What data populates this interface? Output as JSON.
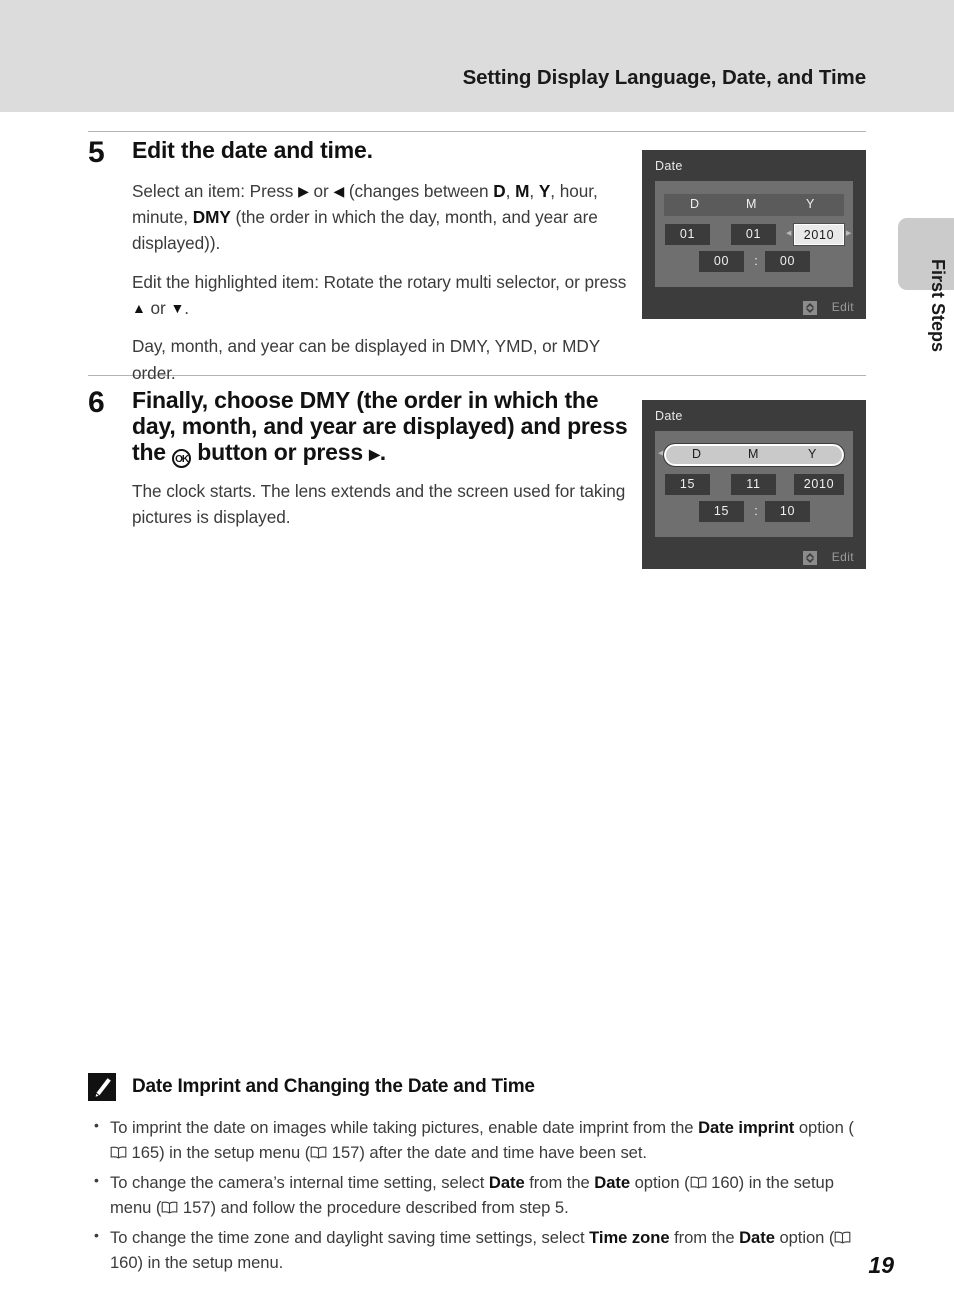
{
  "header": {
    "title": "Setting Display Language, Date, and Time"
  },
  "side_tab": {
    "label": "First Steps"
  },
  "steps": [
    {
      "number": "5",
      "heading": "Edit the date and time.",
      "paragraphs": [
        {
          "segments": [
            {
              "t": "Select an item: Press ",
              "style": "normal"
            },
            {
              "t": "▶",
              "style": "glyph"
            },
            {
              "t": " or ",
              "style": "normal"
            },
            {
              "t": "◀",
              "style": "glyph"
            },
            {
              "t": " (changes between ",
              "style": "normal"
            },
            {
              "t": "D",
              "style": "bold"
            },
            {
              "t": ", ",
              "style": "normal"
            },
            {
              "t": "M",
              "style": "bold"
            },
            {
              "t": ", ",
              "style": "normal"
            },
            {
              "t": "Y",
              "style": "bold"
            },
            {
              "t": ", hour, minute, ",
              "style": "normal"
            },
            {
              "t": "DMY",
              "style": "bold"
            },
            {
              "t": " (the order in which the day, month, and year are displayed)).",
              "style": "normal"
            }
          ]
        },
        {
          "segments": [
            {
              "t": "Edit the highlighted item: Rotate the rotary multi selector, or press ",
              "style": "normal"
            },
            {
              "t": "▲",
              "style": "glyph"
            },
            {
              "t": " or ",
              "style": "normal"
            },
            {
              "t": "▼",
              "style": "glyph"
            },
            {
              "t": ".",
              "style": "normal"
            }
          ]
        },
        {
          "segments": [
            {
              "t": "Day, month, and year can be displayed in DMY, YMD, or MDY order.",
              "style": "normal"
            }
          ]
        }
      ]
    },
    {
      "number": "6",
      "heading_segments": [
        {
          "t": "Finally, choose ",
          "style": "normal"
        },
        {
          "t": "DMY",
          "style": "bold"
        },
        {
          "t": " (the order in which the day, month, and year are displayed) and press the ",
          "style": "normal"
        },
        {
          "t": "OK",
          "style": "okbutton"
        },
        {
          "t": " button or press ",
          "style": "normal"
        },
        {
          "t": "▶",
          "style": "glyph"
        },
        {
          "t": ".",
          "style": "normal"
        }
      ],
      "paragraphs": [
        {
          "segments": [
            {
              "t": "The clock starts. The lens extends and the screen used for taking pictures is displayed.",
              "style": "normal"
            }
          ]
        }
      ]
    }
  ],
  "lcd_screens": [
    {
      "title": "Date",
      "columns": [
        "D",
        "M",
        "Y"
      ],
      "header_selected": false,
      "day": "01",
      "month": "01",
      "year": "2010",
      "hour": "00",
      "minute": "00",
      "separator": ":",
      "selected_field": "year",
      "footer_label": "Edit",
      "footer_icon": "rotary-updown-icon"
    },
    {
      "title": "Date",
      "columns": [
        "D",
        "M",
        "Y"
      ],
      "header_selected": true,
      "day": "15",
      "month": "11",
      "year": "2010",
      "hour": "15",
      "minute": "10",
      "separator": ":",
      "selected_field": "order",
      "footer_label": "Edit",
      "footer_icon": "rotary-updown-icon"
    }
  ],
  "note": {
    "icon": "pencil-icon",
    "title": "Date Imprint and Changing the Date and Time",
    "items": [
      {
        "segments": [
          {
            "t": "To imprint the date on images while taking pictures, enable date imprint from the ",
            "style": "normal"
          },
          {
            "t": "Date imprint",
            "style": "bold"
          },
          {
            "t": " option (",
            "style": "normal"
          },
          {
            "t": "book",
            "style": "bookicon"
          },
          {
            "t": " 165) in the setup menu (",
            "style": "normal"
          },
          {
            "t": "book",
            "style": "bookicon"
          },
          {
            "t": " 157) after the date and time have been set.",
            "style": "normal"
          }
        ]
      },
      {
        "segments": [
          {
            "t": "To change the camera’s internal time setting, select ",
            "style": "normal"
          },
          {
            "t": "Date",
            "style": "bold"
          },
          {
            "t": " from the ",
            "style": "normal"
          },
          {
            "t": "Date",
            "style": "bold"
          },
          {
            "t": " option (",
            "style": "normal"
          },
          {
            "t": "book",
            "style": "bookicon"
          },
          {
            "t": " 160) in the setup menu (",
            "style": "normal"
          },
          {
            "t": "book",
            "style": "bookicon"
          },
          {
            "t": " 157) and follow the procedure described from step 5.",
            "style": "normal"
          }
        ]
      },
      {
        "segments": [
          {
            "t": "To change the time zone and daylight saving time settings, select ",
            "style": "normal"
          },
          {
            "t": "Time zone",
            "style": "bold"
          },
          {
            "t": " from the ",
            "style": "normal"
          },
          {
            "t": "Date",
            "style": "bold"
          },
          {
            "t": " option (",
            "style": "normal"
          },
          {
            "t": "book",
            "style": "bookicon"
          },
          {
            "t": " 160) in the setup menu.",
            "style": "normal"
          }
        ]
      }
    ]
  },
  "page_number": "19",
  "colors": {
    "header_band": "#dcdcdc",
    "side_tab": "#cbcbcb",
    "lcd_frame": "#3c3c3c",
    "lcd_panel": "#6f6f6f",
    "lcd_value_box": "#3b3b3b",
    "lcd_highlight": "#e9e9e9",
    "rule": "#b4b4b4"
  }
}
